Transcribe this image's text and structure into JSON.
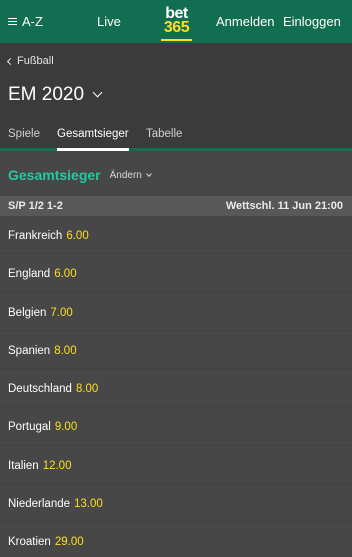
{
  "topbar": {
    "menu_label": "A-Z",
    "live_label": "Live",
    "logo_line1": "bet",
    "logo_line2": "365",
    "register_label": "Anmelden",
    "login_label": "Einloggen"
  },
  "header": {
    "breadcrumb": "Fußball",
    "title": "EM 2020",
    "tabs": [
      {
        "label": "Spiele"
      },
      {
        "label": "Gesamtsieger"
      },
      {
        "label": "Tabelle"
      }
    ]
  },
  "market": {
    "title": "Gesamtsieger",
    "change_label": "Ändern",
    "info_left": "S/P 1/2 1-2",
    "info_right": "Wettschl. 11 Jun 21:00"
  },
  "selections": [
    {
      "team": "Frankreich",
      "odds": "6.00"
    },
    {
      "team": "England",
      "odds": "6.00"
    },
    {
      "team": "Belgien",
      "odds": "7.00"
    },
    {
      "team": "Spanien",
      "odds": "8.00"
    },
    {
      "team": "Deutschland",
      "odds": "8.00"
    },
    {
      "team": "Portugal",
      "odds": "9.00"
    },
    {
      "team": "Italien",
      "odds": "12.00"
    },
    {
      "team": "Niederlande",
      "odds": "13.00"
    },
    {
      "team": "Kroatien",
      "odds": "29.00"
    }
  ],
  "colors": {
    "brand_green": "#126e51",
    "accent_teal": "#22c9a0",
    "odds_yellow": "#ffdf1b"
  }
}
